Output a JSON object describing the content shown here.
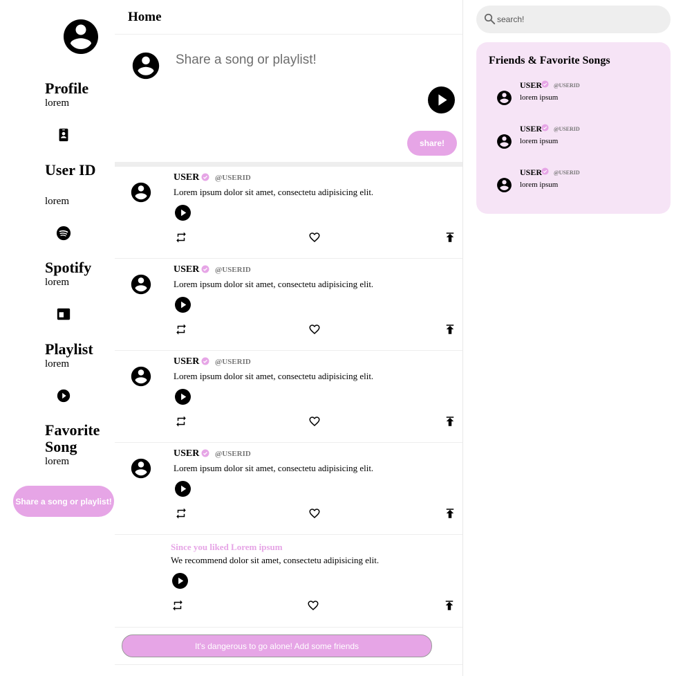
{
  "home": {
    "title": "Home"
  },
  "sidebar": {
    "items": [
      {
        "label": "Profile",
        "value": "lorem",
        "icon": "account-circle-icon"
      },
      {
        "label": "User ID",
        "value": "lorem",
        "icon": "id-badge-icon"
      },
      {
        "label": "Spotify",
        "value": "lorem",
        "icon": "spotify-icon"
      },
      {
        "label": "Playlist",
        "value": "lorem",
        "icon": "playlist-card-icon"
      },
      {
        "label": "Favorite Song",
        "value": "lorem",
        "icon": "play-circle-icon"
      }
    ],
    "share_button": "Share a song or playlist!"
  },
  "composer": {
    "placeholder": "Share a song or playlist!",
    "share_button": "share!"
  },
  "posts": [
    {
      "user": "USER",
      "handle": "@USERID",
      "text": "Lorem ipsum dolor sit amet, consectetu adipisicing elit."
    },
    {
      "user": "USER",
      "handle": "@USERID",
      "text": "Lorem ipsum dolor sit amet, consectetu adipisicing elit."
    },
    {
      "user": "USER",
      "handle": "@USERID",
      "text": "Lorem ipsum dolor sit amet, consectetu adipisicing elit."
    },
    {
      "user": "USER",
      "handle": "@USERID",
      "text": "Lorem ipsum dolor sit amet, consectetu adipisicing elit."
    }
  ],
  "recommendation": {
    "title": "Since you liked Lorem ipsum",
    "text": "We recommend dolor sit amet, consectetu adipisicing elit."
  },
  "friends_button": "It's dangerous to go alone! Add some friends",
  "search": {
    "placeholder": "search!"
  },
  "friends_panel": {
    "title": "Friends & Favorite Songs",
    "friends": [
      {
        "user": "USER",
        "handle": "@USERID",
        "song": "lorem ipsum"
      },
      {
        "user": "USER",
        "handle": "@USERID",
        "song": "lorem ipsum"
      },
      {
        "user": "USER",
        "handle": "@USERID",
        "song": "lorem ipsum"
      }
    ]
  },
  "colors": {
    "accent": "#e6a5e6",
    "panel": "#f6e4f6",
    "divider": "#eeeeee",
    "search_bg": "#eeeeee"
  }
}
